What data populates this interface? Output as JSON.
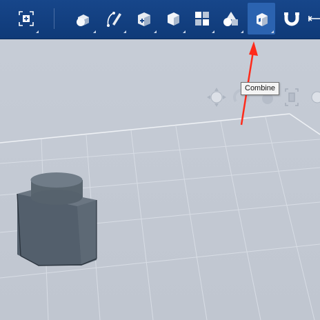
{
  "toolbar": {
    "buttons": [
      {
        "name": "fit-view-icon"
      },
      {
        "name": "primitives-icon"
      },
      {
        "name": "sketch-icon"
      },
      {
        "name": "construct-icon"
      },
      {
        "name": "modify-icon"
      },
      {
        "name": "pattern-icon"
      },
      {
        "name": "grouping-icon"
      },
      {
        "name": "combine-icon",
        "active": true
      },
      {
        "name": "snap-icon"
      },
      {
        "name": "measure-icon"
      }
    ]
  },
  "tooltip": {
    "text": "Combine"
  },
  "colors": {
    "toolbar": "#123f80",
    "active_button": "#2b63b0",
    "viewport": "#c3c9d3",
    "annotation_arrow": "#ff2a1a"
  }
}
